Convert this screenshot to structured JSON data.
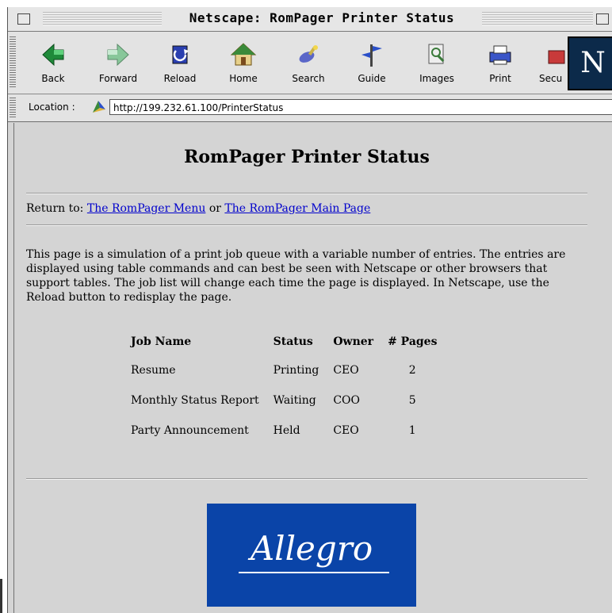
{
  "window": {
    "title": "Netscape: RomPager Printer Status"
  },
  "toolbar": {
    "buttons": [
      {
        "label": "Back",
        "icon": "back-arrow-icon"
      },
      {
        "label": "Forward",
        "icon": "forward-arrow-icon"
      },
      {
        "label": "Reload",
        "icon": "reload-icon"
      },
      {
        "label": "Home",
        "icon": "home-icon"
      },
      {
        "label": "Search",
        "icon": "search-icon"
      },
      {
        "label": "Guide",
        "icon": "guide-icon"
      },
      {
        "label": "Images",
        "icon": "images-icon"
      },
      {
        "label": "Print",
        "icon": "print-icon"
      },
      {
        "label": "Secu",
        "icon": "security-icon"
      }
    ],
    "logo_letter": "N"
  },
  "location": {
    "label": "Location :",
    "url": "http://199.232.61.100/PrinterStatus"
  },
  "page": {
    "title": "RomPager Printer Status",
    "return_prefix": "Return to:",
    "link_menu": "The RomPager Menu",
    "link_or": "or",
    "link_main": "The RomPager Main Page",
    "description": "This page is a simulation of a print job queue with a variable number of entries. The entries are displayed using table commands and can best be seen with Netscape or other browsers that support tables. The job list will change each time the page is displayed. In Netscape, use the Reload button to redisplay the page.",
    "table": {
      "headers": [
        "Job Name",
        "Status",
        "Owner",
        "# Pages"
      ],
      "rows": [
        [
          "Resume",
          "Printing",
          "CEO",
          "2"
        ],
        [
          "Monthly Status Report",
          "Waiting",
          "COO",
          "5"
        ],
        [
          "Party Announcement",
          "Held",
          "CEO",
          "1"
        ]
      ]
    },
    "logo_text": "Allegro"
  },
  "colors": {
    "link": "#0000cc",
    "logo_background": "#0a44a8",
    "window_background": "#d4d4d4"
  }
}
